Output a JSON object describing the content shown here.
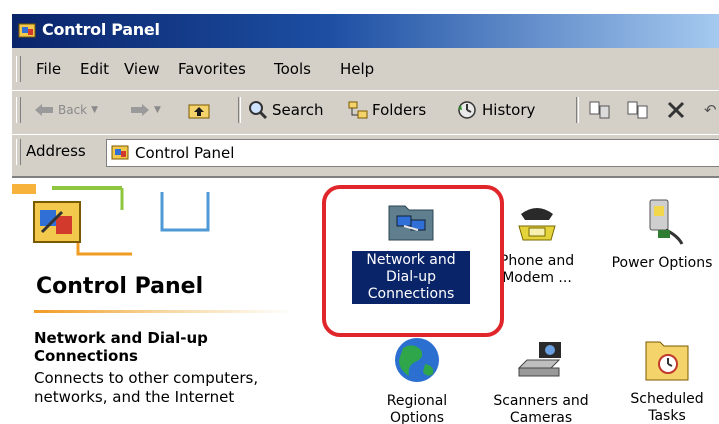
{
  "window": {
    "title": "Control Panel"
  },
  "menu": {
    "items": [
      "File",
      "Edit",
      "View",
      "Favorites",
      "Tools",
      "Help"
    ]
  },
  "toolbar": {
    "back": "Back",
    "search": "Search",
    "folders": "Folders",
    "history": "History"
  },
  "address": {
    "label": "Address",
    "value": "Control Panel"
  },
  "panel": {
    "heading": "Control Panel",
    "selected_title": "Network and Dial-up Connections",
    "selected_description": "Connects to other computers, networks, and the Internet"
  },
  "icons": [
    {
      "name": "network",
      "label": "Network and Dial-up Connections"
    },
    {
      "name": "phone",
      "label": "Phone and Modem ..."
    },
    {
      "name": "power",
      "label": "Power Options"
    },
    {
      "name": "regional",
      "label": "Regional Options"
    },
    {
      "name": "scanners",
      "label": "Scanners and Cameras"
    },
    {
      "name": "scheduled",
      "label": "Scheduled Tasks"
    }
  ],
  "colors": {
    "title_bar": "#0a246a",
    "highlight": "#e0262b",
    "selection": "#0a246a"
  }
}
